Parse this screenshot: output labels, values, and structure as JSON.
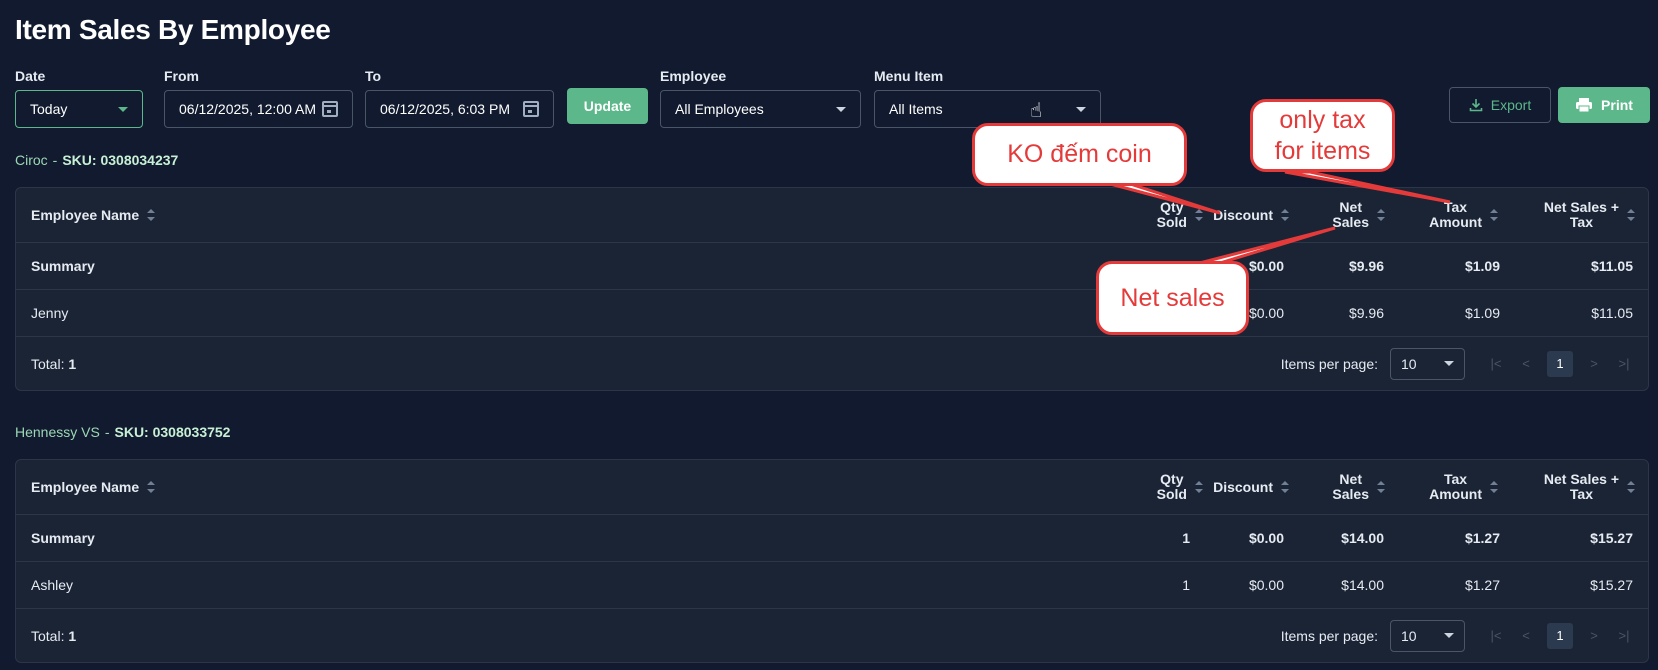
{
  "page": {
    "title": "Item Sales By Employee"
  },
  "filters": {
    "date": {
      "label": "Date",
      "value": "Today"
    },
    "from": {
      "label": "From",
      "value": "06/12/2025, 12:00 AM"
    },
    "to": {
      "label": "To",
      "value": "06/12/2025, 6:03 PM"
    },
    "update_label": "Update",
    "employee": {
      "label": "Employee",
      "value": "All Employees"
    },
    "menu_item": {
      "label": "Menu Item",
      "value": "All Items"
    }
  },
  "actions": {
    "export_label": "Export",
    "print_label": "Print"
  },
  "columns": {
    "employee": "Employee Name",
    "qty_1": "Qty",
    "qty_2": "Sold",
    "discount": "Discount",
    "net_1": "Net",
    "net_2": "Sales",
    "tax_1": "Tax",
    "tax_2": "Amount",
    "nst_1": "Net Sales +",
    "nst_2": "Tax"
  },
  "sections": [
    {
      "name": "Ciroc",
      "separator": "-",
      "sku": "SKU: 0308034237",
      "summary": {
        "label": "Summary",
        "qty": "",
        "discount": "$0.00",
        "net": "$9.96",
        "tax": "$1.09",
        "total": "$11.05"
      },
      "rows": [
        {
          "name": "Jenny",
          "qty": "",
          "discount": "$0.00",
          "net": "$9.96",
          "tax": "$1.09",
          "total": "$11.05"
        }
      ],
      "total_label": "Total:",
      "total_count": "1"
    },
    {
      "name": "Hennessy VS",
      "separator": "-",
      "sku": "SKU: 0308033752",
      "summary": {
        "label": "Summary",
        "qty": "1",
        "discount": "$0.00",
        "net": "$14.00",
        "tax": "$1.27",
        "total": "$15.27"
      },
      "rows": [
        {
          "name": "Ashley",
          "qty": "1",
          "discount": "$0.00",
          "net": "$14.00",
          "tax": "$1.27",
          "total": "$15.27"
        }
      ],
      "total_label": "Total:",
      "total_count": "1"
    }
  ],
  "pagination": {
    "items_per_page_label": "Items per page:",
    "per_page_value": "10",
    "current_page": "1",
    "first": "|<",
    "prev": "<",
    "next": ">",
    "last": ">|"
  },
  "annotations": {
    "callout_1": "KO đếm coin",
    "callout_2_line1": "only tax",
    "callout_2_line2": "for items",
    "callout_3": "Net sales",
    "color": "#e43a3a"
  },
  "colors": {
    "accent": "#5cb88a",
    "background": "#111a2e",
    "card": "#1b2435"
  }
}
